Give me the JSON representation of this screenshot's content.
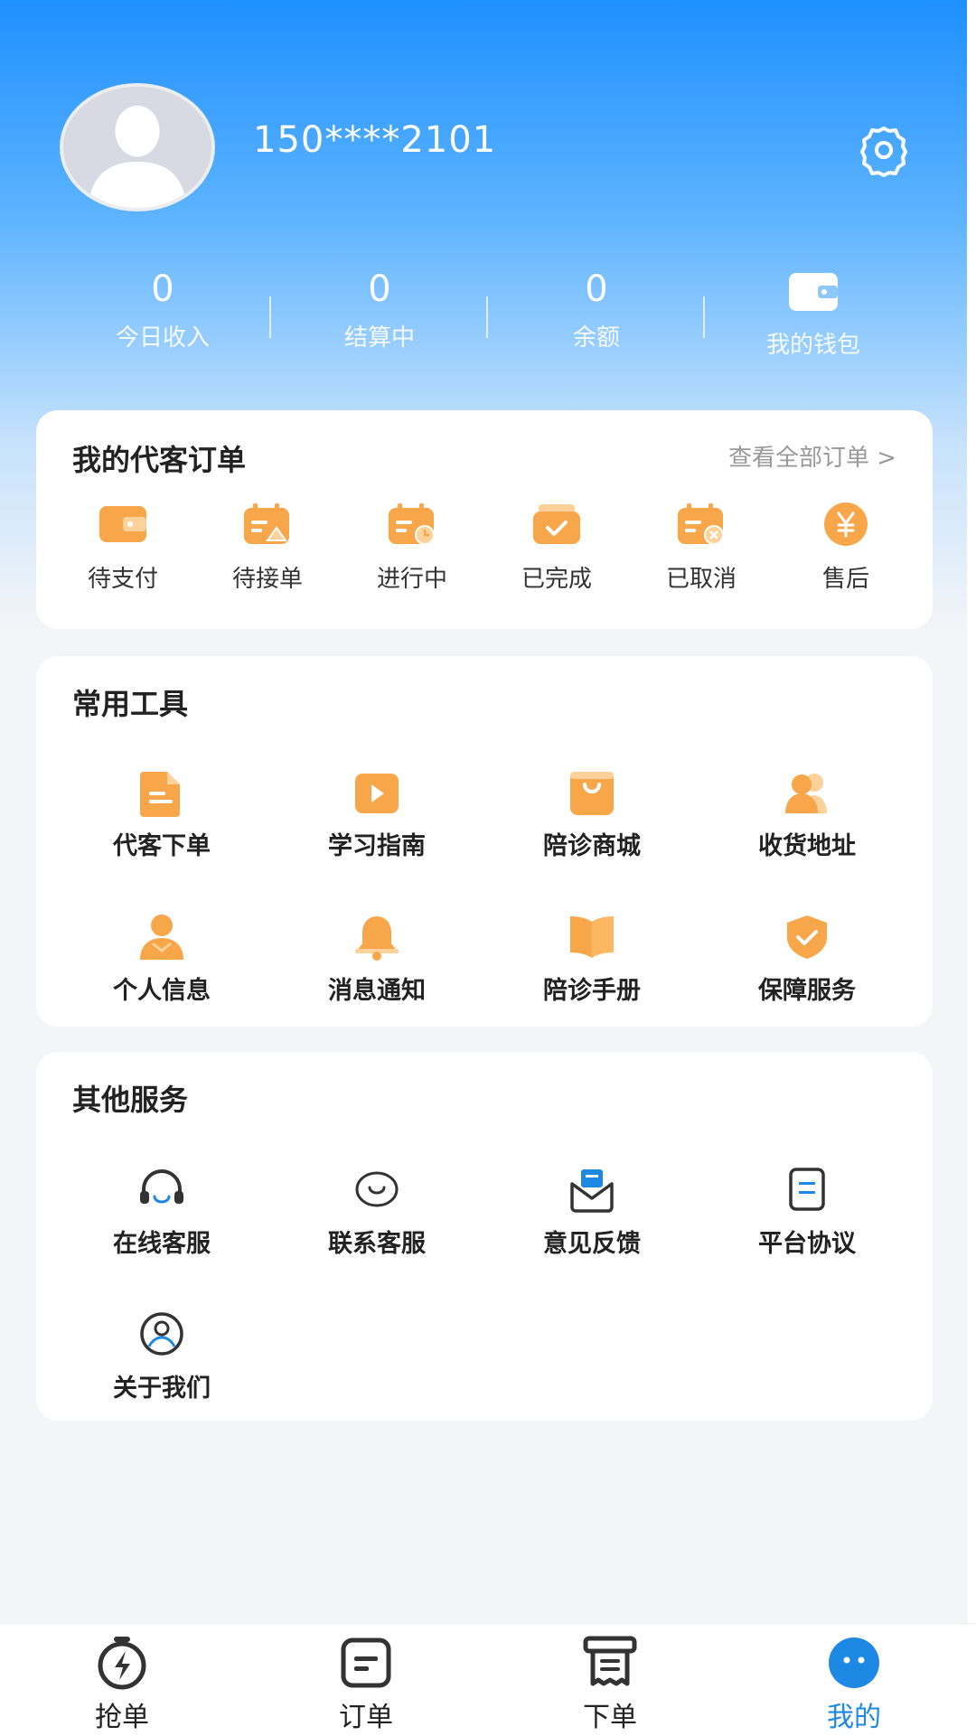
{
  "profile": {
    "phone": "150****2101"
  },
  "stats": [
    {
      "value": "0",
      "label": "今日收入"
    },
    {
      "value": "0",
      "label": "结算中"
    },
    {
      "value": "0",
      "label": "余额"
    }
  ],
  "wallet": {
    "label": "我的钱包"
  },
  "orders": {
    "title": "我的代客订单",
    "more": "查看全部订单 >",
    "items": [
      {
        "label": "待支付",
        "icon": "wallet-icon"
      },
      {
        "label": "待接单",
        "icon": "pending-order-icon"
      },
      {
        "label": "进行中",
        "icon": "in-progress-icon"
      },
      {
        "label": "已完成",
        "icon": "completed-icon"
      },
      {
        "label": "已取消",
        "icon": "cancelled-icon"
      },
      {
        "label": "售后",
        "icon": "yen-icon"
      }
    ]
  },
  "tools": {
    "title": "常用工具",
    "items": [
      {
        "label": "代客下单",
        "icon": "document-icon"
      },
      {
        "label": "学习指南",
        "icon": "play-icon"
      },
      {
        "label": "陪诊商城",
        "icon": "shopping-bag-icon"
      },
      {
        "label": "收货地址",
        "icon": "users-icon"
      },
      {
        "label": "个人信息",
        "icon": "person-icon"
      },
      {
        "label": "消息通知",
        "icon": "bell-icon"
      },
      {
        "label": "陪诊手册",
        "icon": "book-icon"
      },
      {
        "label": "保障服务",
        "icon": "shield-icon"
      }
    ]
  },
  "services": {
    "title": "其他服务",
    "items": [
      {
        "label": "在线客服",
        "icon": "headset-icon"
      },
      {
        "label": "联系客服",
        "icon": "chat-icon"
      },
      {
        "label": "意见反馈",
        "icon": "mail-icon"
      },
      {
        "label": "平台协议",
        "icon": "agreement-icon"
      },
      {
        "label": "关于我们",
        "icon": "about-icon"
      }
    ]
  },
  "tabbar": [
    {
      "label": "抢单",
      "icon": "stopwatch-bolt-icon"
    },
    {
      "label": "订单",
      "icon": "order-list-icon"
    },
    {
      "label": "下单",
      "icon": "place-order-icon"
    },
    {
      "label": "我的",
      "icon": "profile-face-icon",
      "active": true
    }
  ],
  "colors": {
    "accent": "#1e88e5",
    "icon_orange": "#f7a649",
    "header_top": "#1e90ff"
  }
}
